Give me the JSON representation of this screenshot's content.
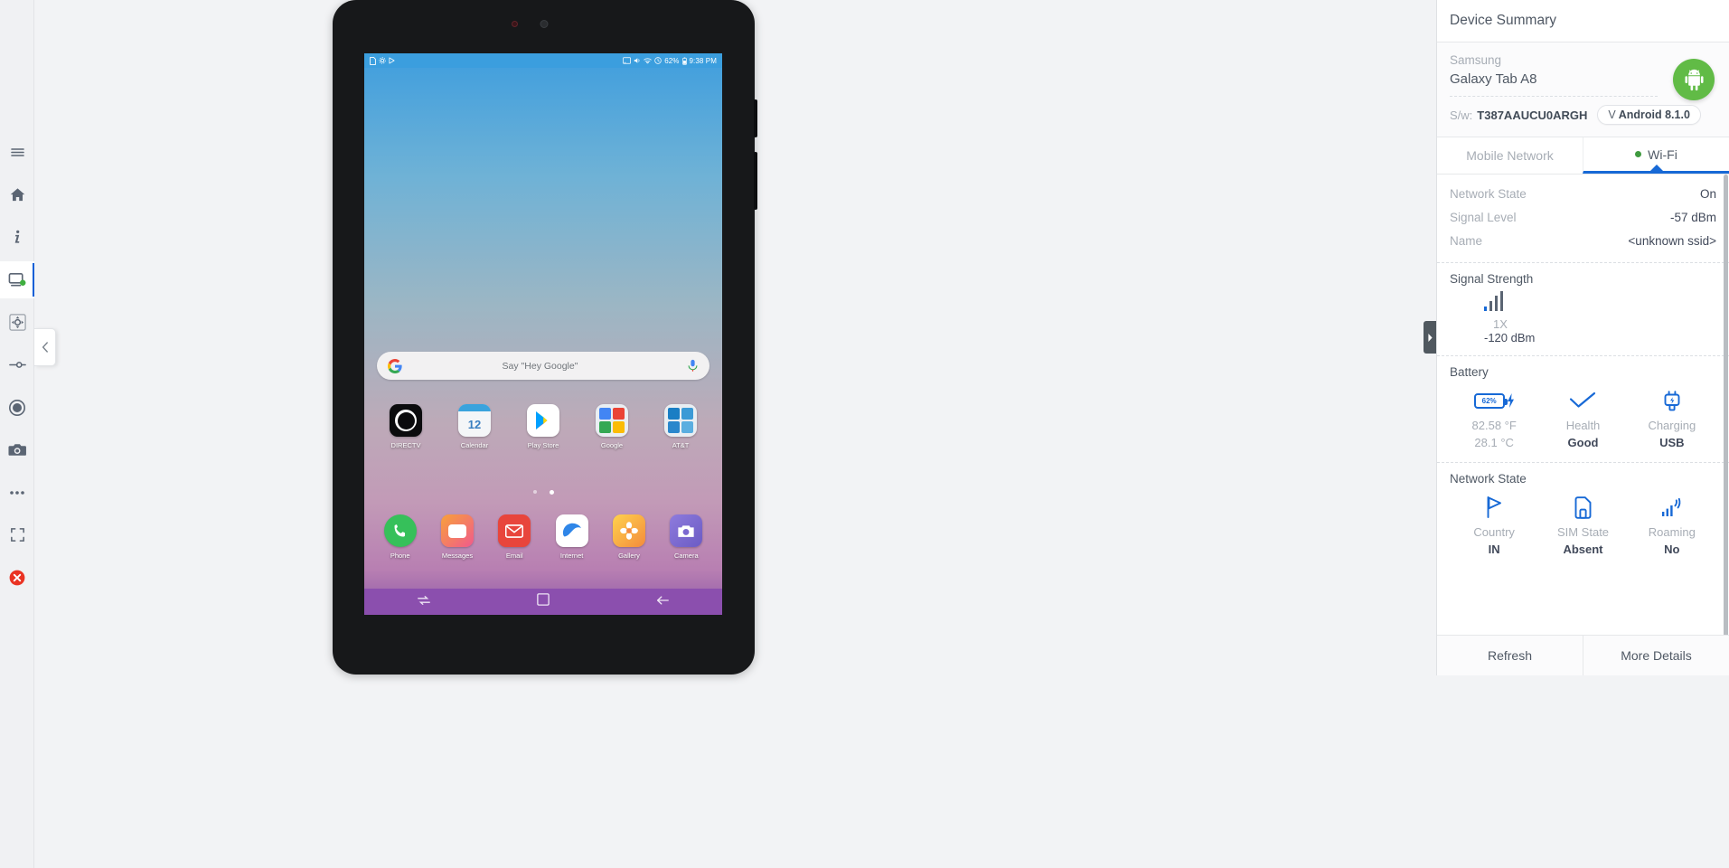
{
  "toolbar": {
    "items": [
      {
        "name": "menu-icon",
        "label": "Menu"
      },
      {
        "name": "home-icon",
        "label": "Home"
      },
      {
        "name": "info-icon",
        "label": "Device Info"
      },
      {
        "name": "monitor-icon",
        "label": "Device View"
      },
      {
        "name": "dpad-icon",
        "label": "Navigation Pad"
      },
      {
        "name": "slider-icon",
        "label": "Settings Slider"
      },
      {
        "name": "record-icon",
        "label": "Record"
      },
      {
        "name": "camera-icon",
        "label": "Screenshot"
      },
      {
        "name": "more-icon",
        "label": "More"
      },
      {
        "name": "fullscreen-icon",
        "label": "Fullscreen"
      },
      {
        "name": "close-icon",
        "label": "Close Session"
      }
    ]
  },
  "device": {
    "statusbar": {
      "left_icons": [
        "sim-icon",
        "settings-icon",
        "play-icon"
      ],
      "right_icons": [
        "cast-icon",
        "volume-icon",
        "wifi-icon",
        "clock-icon"
      ],
      "battery": "62%",
      "battery_icon": "battery-icon",
      "time": "9:38 PM"
    },
    "search": {
      "google_icon": "google-g-icon",
      "hint": "Say \"Hey Google\"",
      "mic_icon": "microphone-icon"
    },
    "page_dots": {
      "count": 2,
      "active_index": 1
    },
    "apps_row1": [
      {
        "label": "DIRECTV",
        "icon": "directv-icon"
      },
      {
        "label": "Calendar",
        "icon": "calendar-icon"
      },
      {
        "label": "Play Store",
        "icon": "play-store-icon"
      },
      {
        "label": "Google",
        "icon": "google-folder-icon"
      },
      {
        "label": "AT&T",
        "icon": "att-folder-icon"
      }
    ],
    "apps_row2": [
      {
        "label": "Phone",
        "icon": "phone-icon"
      },
      {
        "label": "Messages",
        "icon": "messages-icon"
      },
      {
        "label": "Email",
        "icon": "email-icon"
      },
      {
        "label": "Internet",
        "icon": "internet-icon"
      },
      {
        "label": "Gallery",
        "icon": "gallery-icon"
      },
      {
        "label": "Camera",
        "icon": "camera-app-icon"
      }
    ],
    "navbar": [
      "recents-icon",
      "home-nav-icon",
      "back-icon"
    ]
  },
  "panel": {
    "title": "Device Summary",
    "vendor": "Samsung",
    "model": "Galaxy Tab A8",
    "sw_label": "S/w:",
    "sw_value": "T387AAUCU0ARGH",
    "os_prefix": "V",
    "os_version": "Android 8.1.0",
    "android_icon": "android-robot-icon",
    "tabs": [
      {
        "label": "Mobile Network",
        "selected": false,
        "dot": false
      },
      {
        "label": "Wi-Fi",
        "selected": true,
        "dot": true
      }
    ],
    "network": [
      {
        "key": "Network State",
        "value": "On"
      },
      {
        "key": "Signal Level",
        "value": "-57 dBm"
      },
      {
        "key": "Name",
        "value": "<unknown ssid>"
      }
    ],
    "signal": {
      "title": "Signal Strength",
      "icon": "signal-bars-icon",
      "bars_total": 4,
      "bars_active": 1,
      "type": "1X",
      "dbm": "-120 dBm"
    },
    "battery": {
      "title": "Battery",
      "cells": [
        {
          "icon": "battery-charging-icon",
          "badge": "62%",
          "line1": "82.58 °F",
          "line2": "28.1 °C",
          "line2_bold": false
        },
        {
          "icon": "check-icon",
          "badge": "",
          "line1": "Health",
          "line2": "Good",
          "line2_bold": true
        },
        {
          "icon": "plug-icon",
          "badge": "",
          "line1": "Charging",
          "line2": "USB",
          "line2_bold": true
        }
      ]
    },
    "network_state": {
      "title": "Network State",
      "cells": [
        {
          "icon": "flag-icon",
          "line1": "Country",
          "line2": "IN"
        },
        {
          "icon": "sim-card-icon",
          "line1": "SIM State",
          "line2": "Absent"
        },
        {
          "icon": "roaming-icon",
          "line1": "Roaming",
          "line2": "No"
        }
      ]
    },
    "footer": [
      {
        "label": "Refresh"
      },
      {
        "label": "More Details"
      }
    ],
    "colors": {
      "accent": "#1769d6",
      "android_green": "#61bb46",
      "muted": "#a7adb5",
      "text": "#4f5864"
    }
  }
}
